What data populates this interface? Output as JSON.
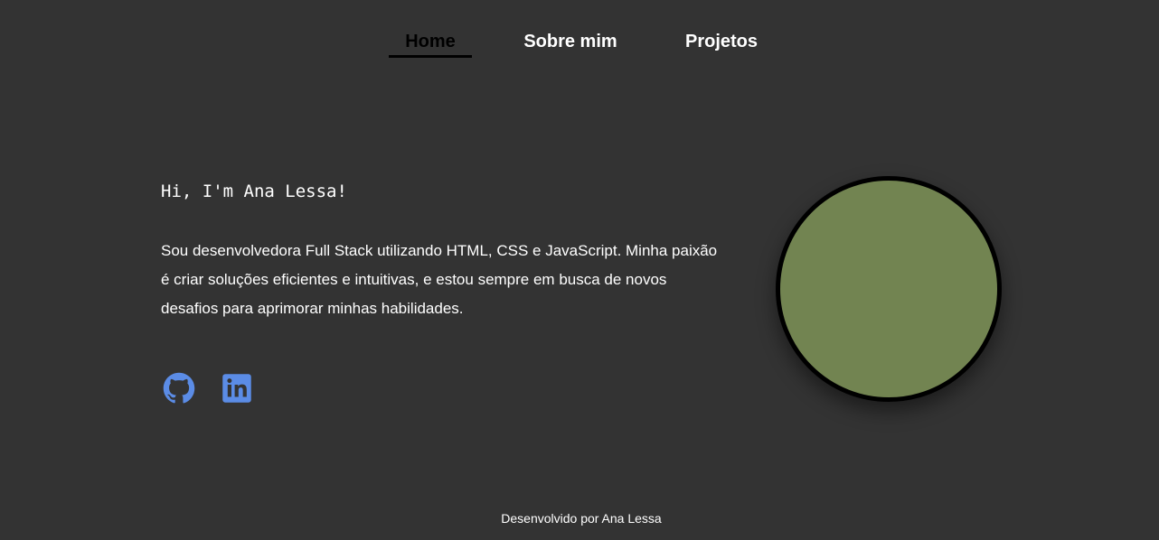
{
  "nav": {
    "items": [
      {
        "label": "Home",
        "active": true
      },
      {
        "label": "Sobre mim",
        "active": false
      },
      {
        "label": "Projetos",
        "active": false
      }
    ]
  },
  "hero": {
    "greeting": "Hi, I'm Ana Lessa!",
    "intro": "Sou desenvolvedora Full Stack utilizando HTML, CSS e JavaScript. Minha paixão é criar soluções eficientes e intuitivas, e estou sempre em busca de novos desafios para aprimorar minhas habilidades."
  },
  "social": {
    "links": [
      {
        "icon": "github-icon"
      },
      {
        "icon": "linkedin-icon"
      }
    ],
    "icon_color": "#5b8ce6"
  },
  "avatar": {
    "fill_color": "#728451",
    "border_color": "#000000"
  },
  "footer": {
    "text": "Desenvolvido por Ana Lessa"
  },
  "colors": {
    "background": "#333333",
    "text": "#ffffff",
    "active_nav": "#000000"
  }
}
